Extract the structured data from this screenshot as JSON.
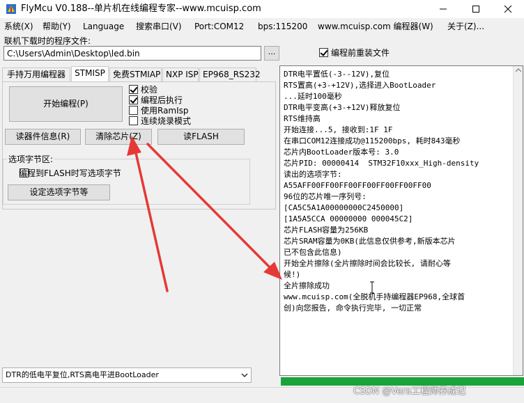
{
  "window": {
    "title": "FlyMcu V0.188--单片机在线编程专家--www.mcuisp.com",
    "minimize_label": "—",
    "maximize_label": "☐",
    "close_label": "✕"
  },
  "menu": [
    "系统(X)",
    "帮助(Y)",
    "Language",
    "搜索串口(V)",
    "Port:COM12",
    "bps:115200",
    "www.mcuisp.com 编程器(W)",
    "关于(Z)..."
  ],
  "file": {
    "label": "联机下载时的程序文件:",
    "path": "C:\\Users\\Admin\\Desktop\\led.bin",
    "browse_label": "...",
    "reload_label": "编程前重装文件",
    "reload_checked": true
  },
  "tabs": [
    "手持万用编程器",
    "STMISP",
    "免费STMIAP",
    "NXP ISP",
    "EP968_RS232"
  ],
  "active_tab": 1,
  "panel": {
    "start_label": "开始编程(P)",
    "options": [
      {
        "label": "校验",
        "checked": true
      },
      {
        "label": "编程后执行",
        "checked": true
      },
      {
        "label": "使用RamIsp",
        "checked": false
      },
      {
        "label": "连续烧录模式",
        "checked": false
      }
    ],
    "read_info_label": "读器件信息(R)",
    "erase_label": "清除芯片(Z)",
    "read_flash_label": "读FLASH",
    "option_group_title": "选项字节区:",
    "option_flash_label": "编程到FLASH时写选项字节",
    "set_option_label": "设定选项字节等"
  },
  "mode_select": "DTR的低电平复位,RTS高电平进BootLoader",
  "log_lines": [
    "DTR电平置低(-3--12V),复位",
    "RTS置高(+3-+12V),选择进入BootLoader",
    "...延时100毫秒",
    "DTR电平变高(+3-+12V)释放复位",
    "RTS维持高",
    "开始连接...5, 接收到:1F 1F",
    "在串口COM12连接成功@115200bps, 耗时843毫秒",
    "芯片内BootLoader版本号: 3.0",
    "芯片PID: 00000414  STM32F10xxx_High-density",
    "读出的选项字节:",
    "A55AFF00FF00FF00FF00FF00FF00FF00",
    "96位的芯片唯一序列号:",
    "[CA5C5A1A00000000C2450000]",
    "[1A5A5CCA 00000000 000045C2]",
    "芯片FLASH容量为256KB",
    "芯片SRAM容量为0KB(此信息仅供参考,新版本芯片",
    "已不包含此信息)",
    "开始全片擦除(全片擦除时间会比较长, 请耐心等",
    "候!)",
    "全片擦除成功",
    "www.mcuisp.com(全脱机手持编程器EP968,全球首",
    "创)向您报告, 命令执行完毕, 一切正常"
  ],
  "progress_fraction": 1.0,
  "watermark": "CSDN @Vera工程师养成记",
  "colors": {
    "progress": "#1aa33a",
    "arrow": "#e53935"
  },
  "icons": {
    "app": "flymcu-icon",
    "select_arrow": "chevron-down-icon"
  }
}
